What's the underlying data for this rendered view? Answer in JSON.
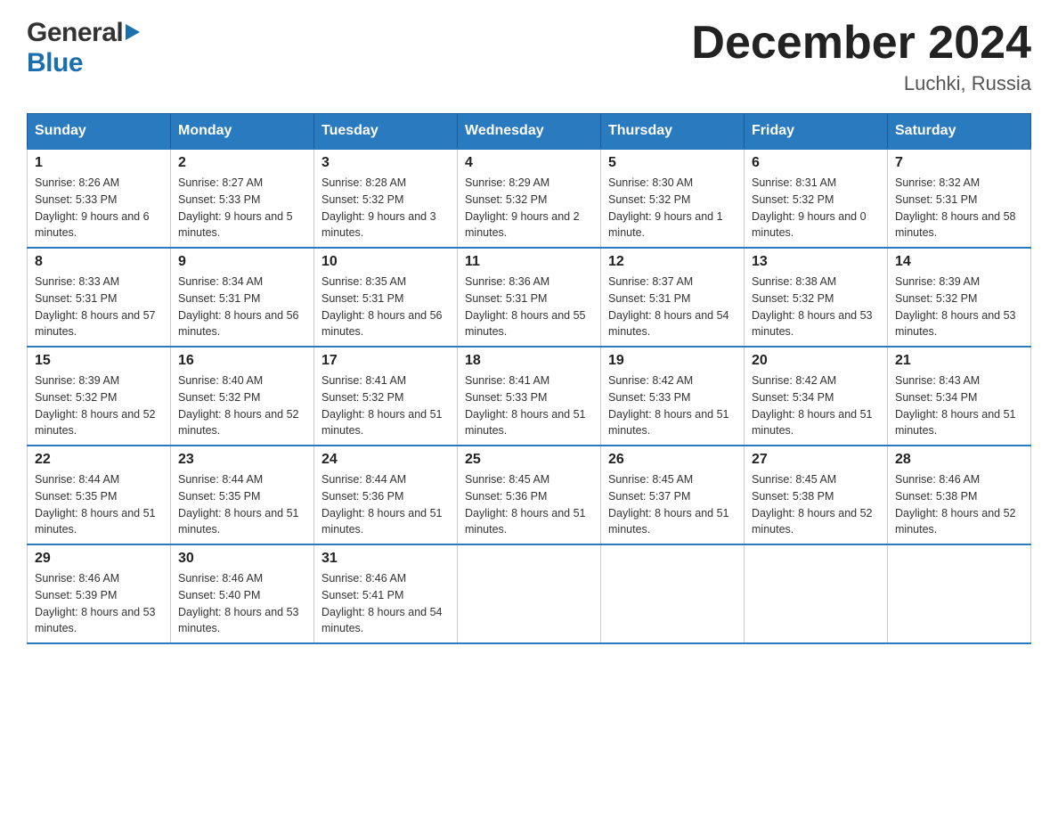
{
  "header": {
    "logo_general": "General",
    "logo_blue": "Blue",
    "month_title": "December 2024",
    "location": "Luchki, Russia"
  },
  "weekdays": [
    "Sunday",
    "Monday",
    "Tuesday",
    "Wednesday",
    "Thursday",
    "Friday",
    "Saturday"
  ],
  "weeks": [
    [
      {
        "day": "1",
        "sunrise": "8:26 AM",
        "sunset": "5:33 PM",
        "daylight": "9 hours and 6 minutes."
      },
      {
        "day": "2",
        "sunrise": "8:27 AM",
        "sunset": "5:33 PM",
        "daylight": "9 hours and 5 minutes."
      },
      {
        "day": "3",
        "sunrise": "8:28 AM",
        "sunset": "5:32 PM",
        "daylight": "9 hours and 3 minutes."
      },
      {
        "day": "4",
        "sunrise": "8:29 AM",
        "sunset": "5:32 PM",
        "daylight": "9 hours and 2 minutes."
      },
      {
        "day": "5",
        "sunrise": "8:30 AM",
        "sunset": "5:32 PM",
        "daylight": "9 hours and 1 minute."
      },
      {
        "day": "6",
        "sunrise": "8:31 AM",
        "sunset": "5:32 PM",
        "daylight": "9 hours and 0 minutes."
      },
      {
        "day": "7",
        "sunrise": "8:32 AM",
        "sunset": "5:31 PM",
        "daylight": "8 hours and 58 minutes."
      }
    ],
    [
      {
        "day": "8",
        "sunrise": "8:33 AM",
        "sunset": "5:31 PM",
        "daylight": "8 hours and 57 minutes."
      },
      {
        "day": "9",
        "sunrise": "8:34 AM",
        "sunset": "5:31 PM",
        "daylight": "8 hours and 56 minutes."
      },
      {
        "day": "10",
        "sunrise": "8:35 AM",
        "sunset": "5:31 PM",
        "daylight": "8 hours and 56 minutes."
      },
      {
        "day": "11",
        "sunrise": "8:36 AM",
        "sunset": "5:31 PM",
        "daylight": "8 hours and 55 minutes."
      },
      {
        "day": "12",
        "sunrise": "8:37 AM",
        "sunset": "5:31 PM",
        "daylight": "8 hours and 54 minutes."
      },
      {
        "day": "13",
        "sunrise": "8:38 AM",
        "sunset": "5:32 PM",
        "daylight": "8 hours and 53 minutes."
      },
      {
        "day": "14",
        "sunrise": "8:39 AM",
        "sunset": "5:32 PM",
        "daylight": "8 hours and 53 minutes."
      }
    ],
    [
      {
        "day": "15",
        "sunrise": "8:39 AM",
        "sunset": "5:32 PM",
        "daylight": "8 hours and 52 minutes."
      },
      {
        "day": "16",
        "sunrise": "8:40 AM",
        "sunset": "5:32 PM",
        "daylight": "8 hours and 52 minutes."
      },
      {
        "day": "17",
        "sunrise": "8:41 AM",
        "sunset": "5:32 PM",
        "daylight": "8 hours and 51 minutes."
      },
      {
        "day": "18",
        "sunrise": "8:41 AM",
        "sunset": "5:33 PM",
        "daylight": "8 hours and 51 minutes."
      },
      {
        "day": "19",
        "sunrise": "8:42 AM",
        "sunset": "5:33 PM",
        "daylight": "8 hours and 51 minutes."
      },
      {
        "day": "20",
        "sunrise": "8:42 AM",
        "sunset": "5:34 PM",
        "daylight": "8 hours and 51 minutes."
      },
      {
        "day": "21",
        "sunrise": "8:43 AM",
        "sunset": "5:34 PM",
        "daylight": "8 hours and 51 minutes."
      }
    ],
    [
      {
        "day": "22",
        "sunrise": "8:44 AM",
        "sunset": "5:35 PM",
        "daylight": "8 hours and 51 minutes."
      },
      {
        "day": "23",
        "sunrise": "8:44 AM",
        "sunset": "5:35 PM",
        "daylight": "8 hours and 51 minutes."
      },
      {
        "day": "24",
        "sunrise": "8:44 AM",
        "sunset": "5:36 PM",
        "daylight": "8 hours and 51 minutes."
      },
      {
        "day": "25",
        "sunrise": "8:45 AM",
        "sunset": "5:36 PM",
        "daylight": "8 hours and 51 minutes."
      },
      {
        "day": "26",
        "sunrise": "8:45 AM",
        "sunset": "5:37 PM",
        "daylight": "8 hours and 51 minutes."
      },
      {
        "day": "27",
        "sunrise": "8:45 AM",
        "sunset": "5:38 PM",
        "daylight": "8 hours and 52 minutes."
      },
      {
        "day": "28",
        "sunrise": "8:46 AM",
        "sunset": "5:38 PM",
        "daylight": "8 hours and 52 minutes."
      }
    ],
    [
      {
        "day": "29",
        "sunrise": "8:46 AM",
        "sunset": "5:39 PM",
        "daylight": "8 hours and 53 minutes."
      },
      {
        "day": "30",
        "sunrise": "8:46 AM",
        "sunset": "5:40 PM",
        "daylight": "8 hours and 53 minutes."
      },
      {
        "day": "31",
        "sunrise": "8:46 AM",
        "sunset": "5:41 PM",
        "daylight": "8 hours and 54 minutes."
      },
      null,
      null,
      null,
      null
    ]
  ],
  "labels": {
    "sunrise": "Sunrise:",
    "sunset": "Sunset:",
    "daylight": "Daylight:"
  }
}
